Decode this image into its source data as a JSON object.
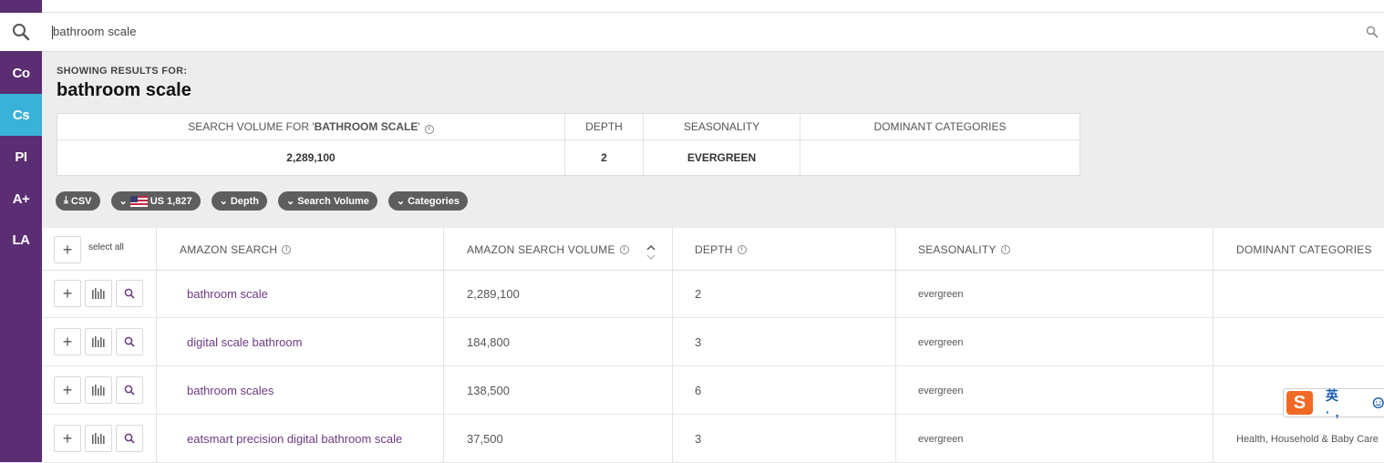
{
  "search": {
    "query": "bathroom scale"
  },
  "sidebar": {
    "items": [
      {
        "label": "Co",
        "active": false
      },
      {
        "label": "Cs",
        "active": true
      },
      {
        "label": "PI",
        "active": false
      },
      {
        "label": "A+",
        "active": false
      },
      {
        "label": "LA",
        "active": false
      }
    ]
  },
  "results": {
    "showing_label": "SHOWING RESULTS FOR:",
    "term": "bathroom scale"
  },
  "summary": {
    "headers": {
      "volume_prefix": "SEARCH VOLUME FOR '",
      "volume_term": "BATHROOM SCALE",
      "volume_suffix": "'",
      "depth": "DEPTH",
      "seasonality": "SEASONALITY",
      "categories": "DOMINANT CATEGORIES"
    },
    "values": {
      "volume": "2,289,100",
      "depth": "2",
      "seasonality": "EVERGREEN",
      "categories": ""
    }
  },
  "chips": {
    "csv": "CSV",
    "country": "US 1,827",
    "depth": "Depth",
    "volume": "Search Volume",
    "categories": "Categories"
  },
  "table": {
    "select_all": "select all",
    "headers": {
      "search": "AMAZON SEARCH",
      "volume": "AMAZON SEARCH VOLUME",
      "depth": "DEPTH",
      "seasonality": "SEASONALITY",
      "categories": "DOMINANT CATEGORIES"
    },
    "rows": [
      {
        "keyword": "bathroom scale",
        "volume": "2,289,100",
        "depth": "2",
        "seasonality": "evergreen",
        "categories": ""
      },
      {
        "keyword": "digital scale bathroom",
        "volume": "184,800",
        "depth": "3",
        "seasonality": "evergreen",
        "categories": ""
      },
      {
        "keyword": "bathroom scales",
        "volume": "138,500",
        "depth": "6",
        "seasonality": "evergreen",
        "categories": ""
      },
      {
        "keyword": "eatsmart precision digital bathroom scale",
        "volume": "37,500",
        "depth": "3",
        "seasonality": "evergreen",
        "categories": "Health, Household & Baby Care"
      }
    ]
  },
  "ime": {
    "logo": "S",
    "text": "英 ·,"
  },
  "colors": {
    "sidebar": "#5b2d73",
    "active": "#39b1d9",
    "keyword": "#6c3a82",
    "chip": "#5e5e5e"
  }
}
